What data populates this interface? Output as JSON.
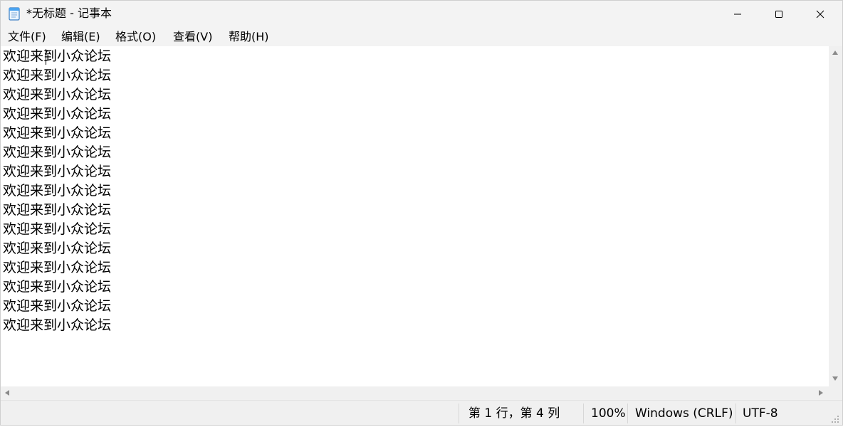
{
  "window": {
    "title": "*无标题 - 记事本"
  },
  "menu": [
    "文件(F)",
    "编辑(E)",
    "格式(O)",
    "查看(V)",
    "帮助(H)"
  ],
  "editor": {
    "lines": [
      "欢迎来到小众论坛",
      "欢迎来到小众论坛",
      "欢迎来到小众论坛",
      "欢迎来到小众论坛",
      "欢迎来到小众论坛",
      "欢迎来到小众论坛",
      "欢迎来到小众论坛",
      "欢迎来到小众论坛",
      "欢迎来到小众论坛",
      "欢迎来到小众论坛",
      "欢迎来到小众论坛",
      "欢迎来到小众论坛",
      "欢迎来到小众论坛",
      "欢迎来到小众论坛",
      "欢迎来到小众论坛"
    ]
  },
  "status": {
    "position": "第 1 行，第 4 列",
    "zoom": "100%",
    "line_ending": "Windows (CRLF)",
    "encoding": "UTF-8"
  },
  "icons": {
    "app": "notepad-icon",
    "minimize": "minimize-icon",
    "maximize": "maximize-icon",
    "close": "close-icon"
  }
}
